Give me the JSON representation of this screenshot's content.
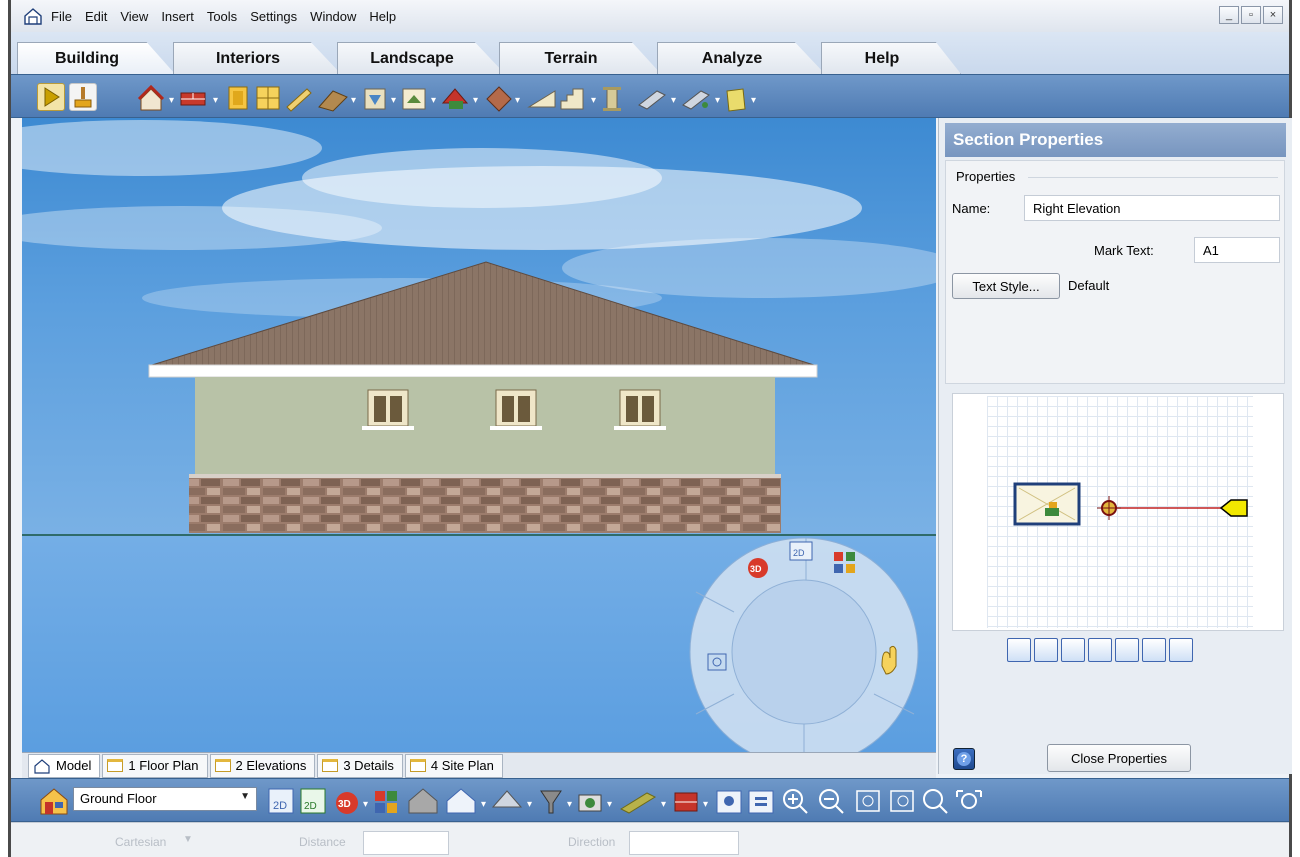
{
  "menubar": {
    "items": [
      "File",
      "Edit",
      "View",
      "Insert",
      "Tools",
      "Settings",
      "Window",
      "Help"
    ],
    "window_buttons": [
      "_",
      "▫",
      "×"
    ]
  },
  "ribbon": {
    "tabs": [
      "Building",
      "Interiors",
      "Landscape",
      "Terrain",
      "Analyze",
      "Help"
    ],
    "active_tab": "Building"
  },
  "section_properties": {
    "title": "Section Properties",
    "group_label": "Properties",
    "name_label": "Name:",
    "name_value": "Right Elevation",
    "mark_text_label": "Mark Text:",
    "mark_text_value": "A1",
    "text_style_button": "Text Style...",
    "text_style_value": "Default",
    "close_button": "Close Properties"
  },
  "view_tabs": [
    "Model",
    "1 Floor Plan",
    "2 Elevations",
    "3 Details",
    "4 Site Plan"
  ],
  "active_view_tab": "Model",
  "bottom_toolbar": {
    "floor_select": "Ground Floor"
  },
  "statusbar": {
    "coord_mode": "Cartesian",
    "distance_label": "Distance",
    "direction_label": "Direction"
  },
  "colors": {
    "toolbar_blue": "#5a86bd",
    "panel_header": "#8aa4c8",
    "roof": "#8a7466",
    "wall": "#b7c2a5",
    "sky": "#4d91d6"
  },
  "icons": {
    "toolbar": [
      "select-arrow-icon",
      "paint-brush-icon",
      "house-wizard-icon",
      "wall-icon",
      "door-icon",
      "window-icon",
      "railing-icon",
      "floor-icon",
      "column-icon",
      "roof-icon",
      "cabinet-icon",
      "ceiling-icon",
      "stairs-icon",
      "pillar-icon",
      "section-icon",
      "dimension-icon",
      "notes-icon"
    ],
    "zoom": [
      "zoom-in-icon",
      "zoom-out-icon",
      "zoom-fit-icon",
      "zoom-window-icon",
      "zoom-previous-icon",
      "zoom-extents-icon",
      "pan-hand-icon"
    ]
  }
}
